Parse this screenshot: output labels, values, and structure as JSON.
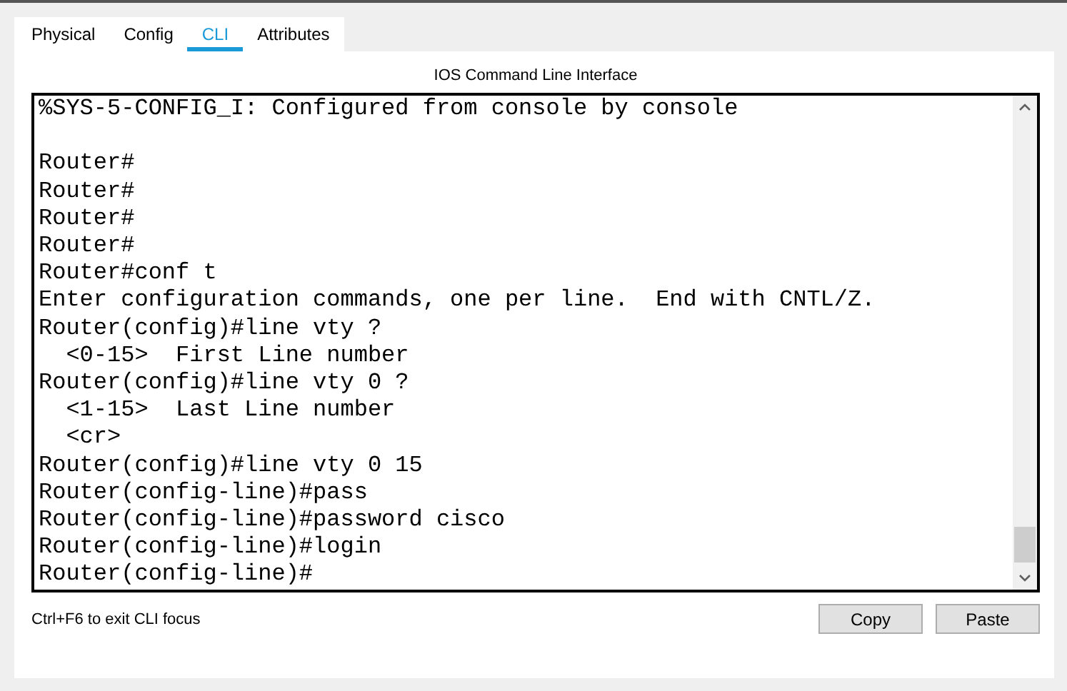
{
  "tabs": [
    {
      "label": "Physical",
      "selected": false
    },
    {
      "label": "Config",
      "selected": false
    },
    {
      "label": "CLI",
      "selected": true
    },
    {
      "label": "Attributes",
      "selected": false
    }
  ],
  "title": "IOS Command Line Interface",
  "terminal": {
    "lines": [
      "%SYS-5-CONFIG_I: Configured from console by console"
    ],
    "after_gap": [
      "Router#",
      "Router#",
      "Router#",
      "Router#",
      "Router#conf t",
      "Enter configuration commands, one per line.  End with CNTL/Z.",
      "Router(config)#line vty ?",
      "  <0-15>  First Line number",
      "Router(config)#line vty 0 ?",
      "  <1-15>  Last Line number",
      "  <cr>",
      "Router(config)#line vty 0 15",
      "Router(config-line)#pass",
      "Router(config-line)#password cisco",
      "Router(config-line)#login",
      "Router(config-line)#"
    ]
  },
  "hint": "Ctrl+F6 to exit CLI focus",
  "buttons": [
    "Copy",
    "Paste"
  ]
}
